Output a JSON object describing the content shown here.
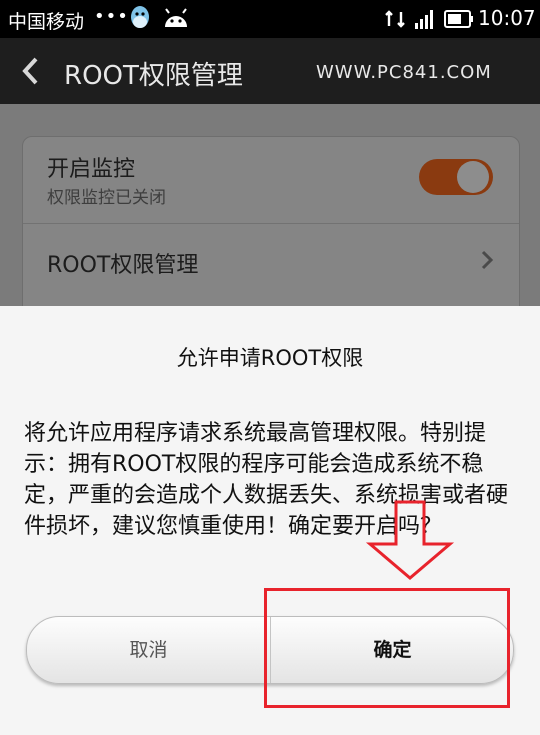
{
  "status_bar": {
    "carrier": "中国移动",
    "dots": "•••",
    "time": "10:07",
    "icons": [
      "qq-icon",
      "android-icon",
      "sync-icon",
      "signal-icon",
      "battery-icon"
    ]
  },
  "title_bar": {
    "title": "ROOT权限管理",
    "watermark": "WWW.PC841.COM",
    "back_icon": "chevron-left-icon"
  },
  "settings": {
    "monitor_label": "开启监控",
    "monitor_sub": "权限监控已关闭",
    "monitor_toggle_on": true,
    "root_manage_label": "ROOT权限管理"
  },
  "dialog": {
    "title": "允许申请ROOT权限",
    "message": "将允许应用程序请求系统最高管理权限。特别提示：拥有ROOT权限的程序可能会造成系统不稳定，严重的会造成个人数据丢失、系统损害或者硬件损坏，建议您慎重使用！确定要开启吗？",
    "cancel_label": "取消",
    "ok_label": "确定"
  },
  "annotation": {
    "highlight_color": "#e8232c"
  },
  "colors": {
    "toggle_on": "#8a3a10",
    "titlebar_bg": "#1e1e1e",
    "dialog_bg": "#f5f5f5"
  }
}
